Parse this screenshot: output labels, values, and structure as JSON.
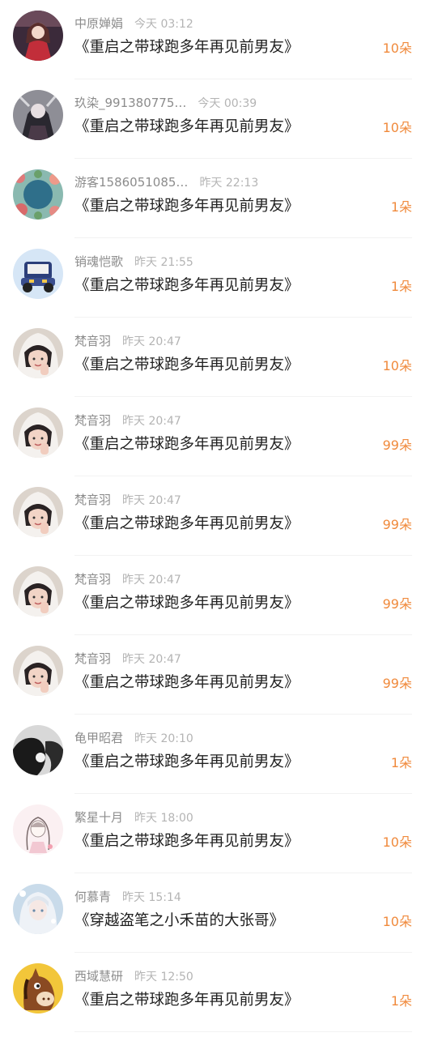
{
  "gifts": [
    {
      "name": "中原婵娟",
      "time": "今天 03:12",
      "book": "《重启之带球跑多年再见前男友》",
      "amount": "10朵",
      "avatar": "character-red-avatar"
    },
    {
      "name": "玖染_991380775…",
      "time": "今天 00:39",
      "book": "《重启之带球跑多年再见前男友》",
      "amount": "10朵",
      "avatar": "character-dark-avatar"
    },
    {
      "name": "游客1586051085…",
      "time": "昨天 22:13",
      "book": "《重启之带球跑多年再见前男友》",
      "amount": "1朵",
      "avatar": "floral-moon-avatar"
    },
    {
      "name": "销魂恺歌",
      "time": "昨天 21:55",
      "book": "《重启之带球跑多年再见前男友》",
      "amount": "1朵",
      "avatar": "toy-car-avatar"
    },
    {
      "name": "梵音羽",
      "time": "昨天 20:47",
      "book": "《重启之带球跑多年再见前男友》",
      "amount": "10朵",
      "avatar": "girl-photo-avatar"
    },
    {
      "name": "梵音羽",
      "time": "昨天 20:47",
      "book": "《重启之带球跑多年再见前男友》",
      "amount": "99朵",
      "avatar": "girl-photo-avatar"
    },
    {
      "name": "梵音羽",
      "time": "昨天 20:47",
      "book": "《重启之带球跑多年再见前男友》",
      "amount": "99朵",
      "avatar": "girl-photo-avatar"
    },
    {
      "name": "梵音羽",
      "time": "昨天 20:47",
      "book": "《重启之带球跑多年再见前男友》",
      "amount": "99朵",
      "avatar": "girl-photo-avatar"
    },
    {
      "name": "梵音羽",
      "time": "昨天 20:47",
      "book": "《重启之带球跑多年再见前男友》",
      "amount": "99朵",
      "avatar": "girl-photo-avatar"
    },
    {
      "name": "龟甲昭君",
      "time": "昨天 20:10",
      "book": "《重启之带球跑多年再见前男友》",
      "amount": "1朵",
      "avatar": "bw-silhouette-avatar"
    },
    {
      "name": "繁星十月",
      "time": "昨天 18:00",
      "book": "《重启之带球跑多年再见前男友》",
      "amount": "10朵",
      "avatar": "sketch-girl-avatar"
    },
    {
      "name": "何慕青",
      "time": "昨天 15:14",
      "book": "《穿越盗笔之小禾苗的大张哥》",
      "amount": "10朵",
      "avatar": "white-hair-avatar"
    },
    {
      "name": "西域慧研",
      "time": "昨天 12:50",
      "book": "《重启之带球跑多年再见前男友》",
      "amount": "1朵",
      "avatar": "horse-cartoon-avatar"
    }
  ],
  "colors": {
    "accent": "#f08a3c",
    "name": "#8c8c8c",
    "time": "#b4b4b4",
    "title": "#1f1f1f"
  }
}
